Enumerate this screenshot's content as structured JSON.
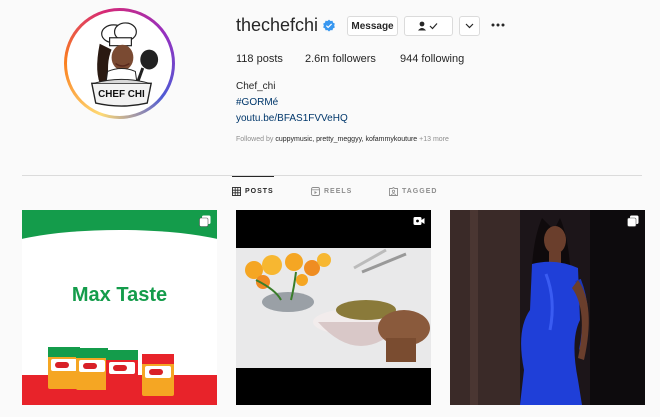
{
  "profile": {
    "username": "thechefchi",
    "message_label": "Message",
    "stats": {
      "posts_count": "118",
      "posts_label": "posts",
      "followers_count": "2.6m",
      "followers_label": "followers",
      "following_count": "944",
      "following_label": "following"
    },
    "full_name": "Chef_chi",
    "hashtag": "#GORMé",
    "link": "youtu.be/BFAS1FVVeHQ",
    "followed_by_prefix": "Followed by",
    "followed_by_names": "cuppymusic, pretty_meggyy, kofammykouture",
    "followed_by_more": "+13 more",
    "avatar_text": "CHEF CHI"
  },
  "tabs": [
    {
      "label": "POSTS",
      "icon": "grid-icon",
      "active": true
    },
    {
      "label": "REELS",
      "icon": "reels-icon",
      "active": false
    },
    {
      "label": "TAGGED",
      "icon": "tagged-icon",
      "active": false
    }
  ],
  "posts": [
    {
      "type": "carousel",
      "icon": "carousel-icon",
      "text": "Max Taste",
      "box_label": "Gino"
    },
    {
      "type": "video",
      "icon": "video-icon"
    },
    {
      "type": "carousel",
      "icon": "carousel-icon"
    }
  ],
  "colors": {
    "verified": "#3897f0",
    "link": "#00376b",
    "brand_green": "#149c4b",
    "brand_red": "#e8232a"
  }
}
